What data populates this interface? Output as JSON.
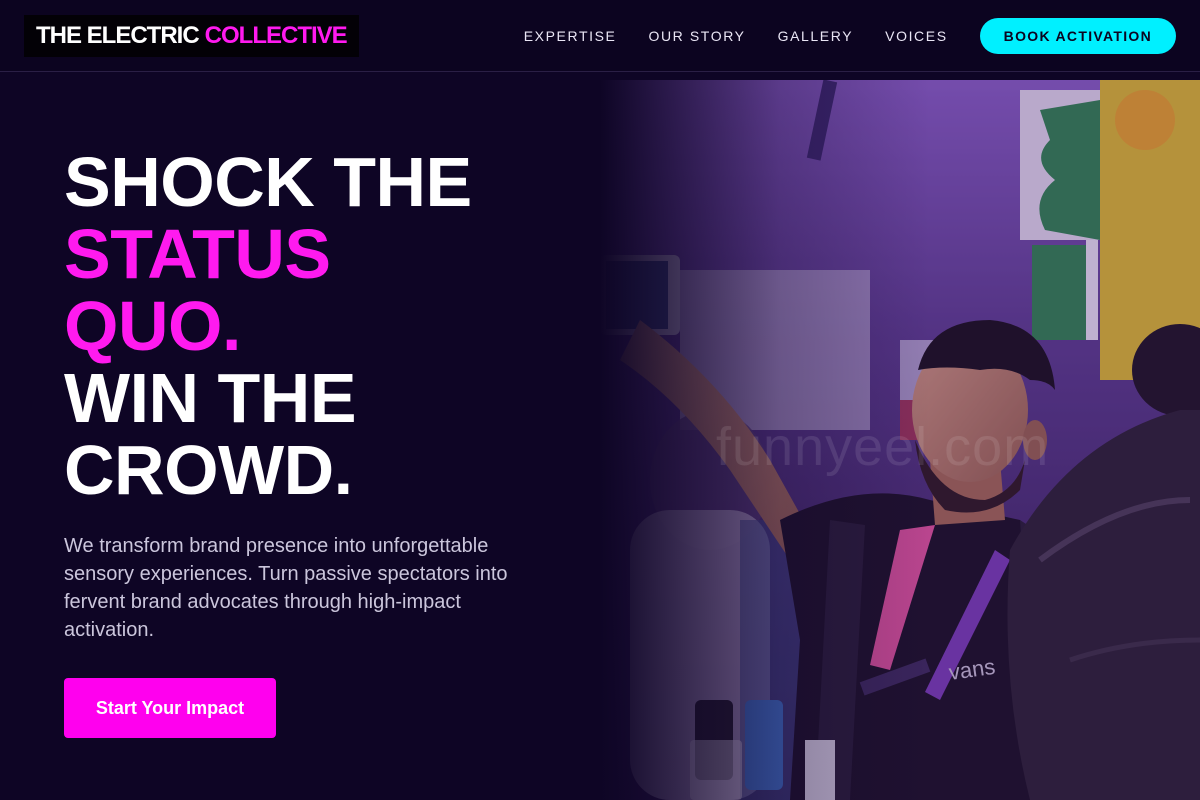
{
  "brand": {
    "name_primary": "THE ELECTRIC",
    "name_accent": "COLLECTIVE"
  },
  "nav": {
    "links": [
      "EXPERTISE",
      "OUR STORY",
      "GALLERY",
      "VOICES"
    ],
    "cta_label": "BOOK ACTIVATION"
  },
  "hero": {
    "headline": {
      "line1": "SHOCK THE",
      "line2": "STATUS",
      "line3": "QUO.",
      "line4": "WIN THE",
      "line5": "CROWD."
    },
    "subtext": "We transform brand presence into unforgettable sensory experiences. Turn passive spectators into fervent brand advocates through high-impact activation.",
    "button_label": "Start Your Impact",
    "watermark": "funnyeel.com"
  },
  "colors": {
    "background": "#0e0525",
    "accent_pink": "#ff1aef",
    "accent_cyan": "#00f0ff"
  }
}
